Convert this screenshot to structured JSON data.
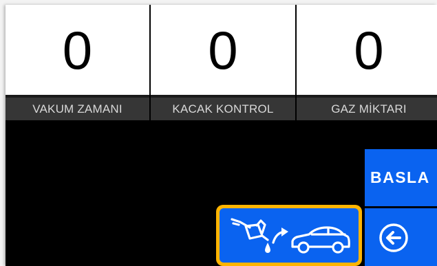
{
  "counters": [
    {
      "value": "0",
      "label": "VAKUM ZAMANI"
    },
    {
      "value": "0",
      "label": "KACAK KONTROL"
    },
    {
      "value": "0",
      "label": "GAZ MİKTARI"
    }
  ],
  "actions": {
    "start_label": "BASLA",
    "back_icon": "arrow-left-circle-icon",
    "oil_icon": "oil-can-to-car-icon"
  },
  "colors": {
    "button_blue": "#0a63f0",
    "highlight_yellow": "#ffb400",
    "label_background": "#363636",
    "value_background": "#ffffff",
    "screen_background": "#000000"
  }
}
